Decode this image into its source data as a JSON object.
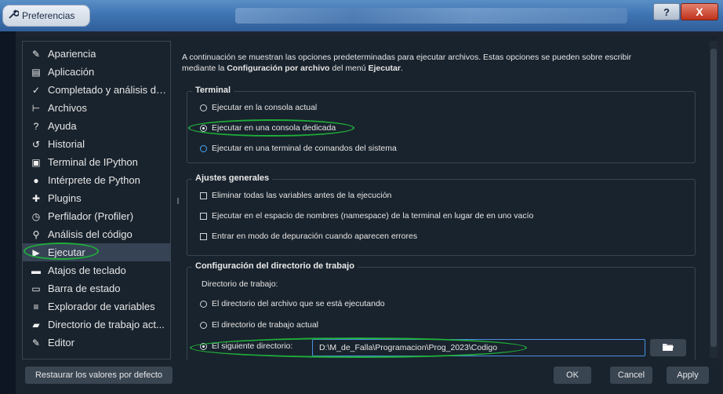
{
  "window": {
    "title": "Preferencias",
    "help_glyph": "?",
    "close_glyph": "X"
  },
  "sidebar": {
    "items": [
      {
        "label": "Apariencia",
        "icon": "wand-icon",
        "glyph": "✎"
      },
      {
        "label": "Aplicación",
        "icon": "app-window-icon",
        "glyph": "▤"
      },
      {
        "label": "Completado y análisis de...",
        "icon": "completion-icon",
        "glyph": "✓"
      },
      {
        "label": "Archivos",
        "icon": "files-tree-icon",
        "glyph": "⊢"
      },
      {
        "label": "Ayuda",
        "icon": "help-icon",
        "glyph": "?"
      },
      {
        "label": "Historial",
        "icon": "history-icon",
        "glyph": "↺"
      },
      {
        "label": "Terminal de IPython",
        "icon": "terminal-icon",
        "glyph": "▣"
      },
      {
        "label": "Intérprete de Python",
        "icon": "python-icon",
        "glyph": "●"
      },
      {
        "label": "Plugins",
        "icon": "puzzle-icon",
        "glyph": "✚"
      },
      {
        "label": "Perfilador (Profiler)",
        "icon": "stopwatch-icon",
        "glyph": "◷"
      },
      {
        "label": "Análisis del código",
        "icon": "code-analysis-icon",
        "glyph": "⚲"
      },
      {
        "label": "Ejecutar",
        "icon": "play-icon",
        "glyph": "▶"
      },
      {
        "label": "Atajos de teclado",
        "icon": "keyboard-icon",
        "glyph": "▬"
      },
      {
        "label": "Barra de estado",
        "icon": "statusbar-icon",
        "glyph": "▭"
      },
      {
        "label": "Explorador de variables",
        "icon": "list-icon",
        "glyph": "≡"
      },
      {
        "label": "Directorio de trabajo act...",
        "icon": "folder-icon",
        "glyph": "▰"
      },
      {
        "label": "Editor",
        "icon": "pen-icon",
        "glyph": "✎"
      }
    ],
    "active_index": 11
  },
  "content": {
    "intro_1": "A continuación se muestran las opciones predeterminadas para ejecutar archivos. Estas opciones se pueden sobre escribir",
    "intro_2a": "mediante la ",
    "intro_2b": "Configuración por archivo",
    "intro_2c": " del menú ",
    "intro_2d": "Ejecutar",
    "intro_2e": ".",
    "terminal": {
      "title": "Terminal",
      "options": [
        "Ejecutar en la consola actual",
        "Ejecutar en una consola dedicada",
        "Ejecutar en una terminal de comandos del sistema"
      ],
      "selected": 1
    },
    "general": {
      "title": "Ajustes generales",
      "options": [
        "Eliminar todas las variables antes de la ejecución",
        "Ejecutar en el espacio de nombres (namespace) de la terminal en lugar de en uno vacío",
        "Entrar en modo de depuración cuando aparecen errores"
      ]
    },
    "workdir": {
      "title": "Configuración del directorio de trabajo",
      "label": "Directorio de trabajo:",
      "options": [
        "El directorio del archivo que se está ejecutando",
        "El directorio de trabajo actual",
        "El siguiente directorio:"
      ],
      "selected": 2,
      "path_value": "D:\\M_de_Falla\\Programacion\\Prog_2023\\Codigo",
      "browse_icon": "folder-open-icon"
    }
  },
  "footer": {
    "reset_label": "Restaurar los valores por defecto",
    "ok_label": "OK",
    "cancel_label": "Cancel",
    "apply_label": "Apply"
  },
  "colors": {
    "highlight": "#1fae3a",
    "accent_blue": "#4a90e2",
    "background": "#19232d"
  }
}
